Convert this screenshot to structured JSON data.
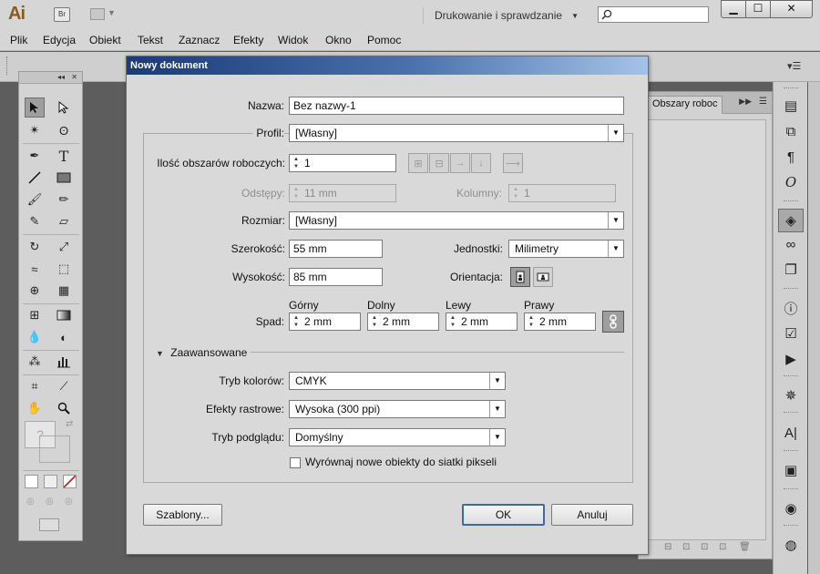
{
  "app": {
    "logo": "Ai",
    "bridge_label": "Br",
    "workspace": "Drukowanie i sprawdzanie",
    "search_placeholder": "",
    "window_buttons": {
      "minimize": "▁",
      "maximize": "☐",
      "close": "✕"
    }
  },
  "menu": [
    "Plik",
    "Edycja",
    "Obiekt",
    "Tekst",
    "Zaznacz",
    "Efekty",
    "Widok",
    "Okno",
    "Pomoc"
  ],
  "artboards_panel": {
    "tab": "Obszary roboc"
  },
  "dialog": {
    "title": "Nowy dokument",
    "name_label": "Nazwa:",
    "name_value": "Bez nazwy-1",
    "profile_label": "Profil:",
    "profile_value": "[Własny]",
    "artboards_label": "Ilość obszarów roboczych:",
    "artboards_value": "1",
    "spacing_label": "Odstępy:",
    "spacing_value": "11 mm",
    "columns_label": "Kolumny:",
    "columns_value": "1",
    "size_label": "Rozmiar:",
    "size_value": "[Własny]",
    "width_label": "Szerokość:",
    "width_value": "55 mm",
    "units_label": "Jednostki:",
    "units_value": "Milimetry",
    "height_label": "Wysokość:",
    "height_value": "85 mm",
    "orientation_label": "Orientacja:",
    "bleed_label": "Spad:",
    "bleed": {
      "top_label": "Górny",
      "top_value": "2 mm",
      "bottom_label": "Dolny",
      "bottom_value": "2 mm",
      "left_label": "Lewy",
      "left_value": "2 mm",
      "right_label": "Prawy",
      "right_value": "2 mm"
    },
    "advanced_label": "Zaawansowane",
    "color_mode_label": "Tryb kolorów:",
    "color_mode_value": "CMYK",
    "raster_label": "Efekty rastrowe:",
    "raster_value": "Wysoka (300 ppi)",
    "preview_label": "Tryb podglądu:",
    "preview_value": "Domyślny",
    "align_pixel_label": "Wyrównaj nowe obiekty do siatki pikseli",
    "align_pixel_checked": false,
    "templates_button": "Szablony...",
    "ok_button": "OK",
    "cancel_button": "Anuluj"
  },
  "colors": {
    "title_bar_start": "#1a3a78",
    "title_bar_end": "#a5c3e8",
    "dialog_bg": "#d9d9d9",
    "canvas_bg": "#5d5d5d"
  }
}
